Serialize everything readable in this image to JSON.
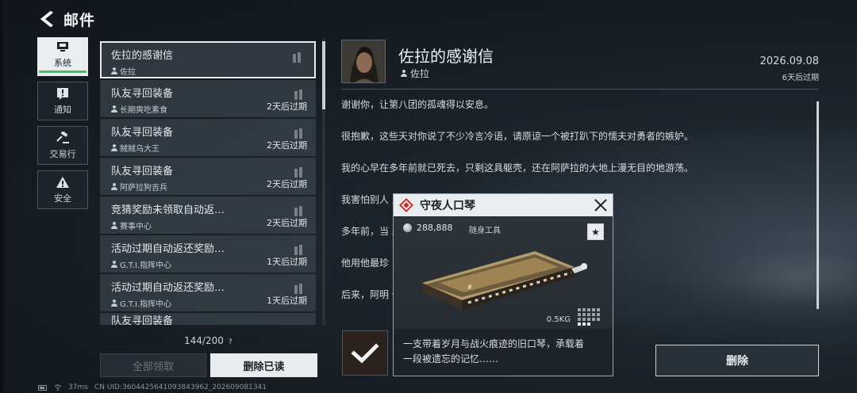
{
  "header": {
    "title": "邮件"
  },
  "categories": [
    {
      "label": "系统",
      "icon": "monitor-icon",
      "active": true
    },
    {
      "label": "通知",
      "icon": "alert-icon",
      "active": false
    },
    {
      "label": "交易行",
      "icon": "gavel-icon",
      "active": false
    },
    {
      "label": "安全",
      "icon": "warning-icon",
      "active": false
    }
  ],
  "mails": [
    {
      "title": "佐拉的感谢信",
      "sender": "佐拉",
      "expiry": ""
    },
    {
      "title": "队友寻回装备",
      "sender": "长期爽吃素食",
      "expiry": "2天后过期"
    },
    {
      "title": "队友寻回装备",
      "sender": "贼贼乌大王",
      "expiry": "2天后过期"
    },
    {
      "title": "队友寻回装备",
      "sender": "阿萨拉狗吉兵",
      "expiry": "2天后过期"
    },
    {
      "title": "竞猜奖励未领取自动返…",
      "sender": "赛事中心",
      "expiry": "2天后过期"
    },
    {
      "title": "活动过期自动返还奖励…",
      "sender": "G.T.I.指挥中心",
      "expiry": "1天后过期"
    },
    {
      "title": "活动过期自动返还奖励…",
      "sender": "G.T.I.指挥中心",
      "expiry": "1天后过期"
    }
  ],
  "mail_partial_title": "队友寻回装备",
  "mail_count": "144/200",
  "mail_count_help": "?",
  "buttons": {
    "claim_all": "全部领取",
    "delete_read": "删除已读",
    "delete": "删除"
  },
  "status": {
    "ping": "37ms",
    "uid": "CN UID:3604425641093843962_202609081341"
  },
  "detail": {
    "title": "佐拉的感谢信",
    "sender": "佐拉",
    "date": "2026.09.08",
    "expiry": "6天后过期",
    "paragraphs": [
      "谢谢你，让第八团的孤魂得以安息。",
      "很抱歉，这些天对你说了不少冷言冷语，请原谅一个被打趴下的懦夫对勇者的嫉妒。",
      "我的心早在多年前就已死去，只剩这具躯壳，还在阿萨拉的大地上漫无目的地游荡。",
      "我害怕别人                                                                          庄、快乐以及理想。",
      "多年前，当                                                                         森将这把口琴塞进我手里。",
      "他用他最珍",
      "后来，阿明                                                                         他的风车、还有他的棕榈"
    ]
  },
  "popup": {
    "title": "守夜人口琴",
    "price": "288,888",
    "type": "随身工具",
    "weight": "0.5KG",
    "description_lines": [
      "一支带着岁月与战火痕迹的旧口琴，承载着",
      "一段被遗忘的记忆……"
    ],
    "star": "★"
  }
}
